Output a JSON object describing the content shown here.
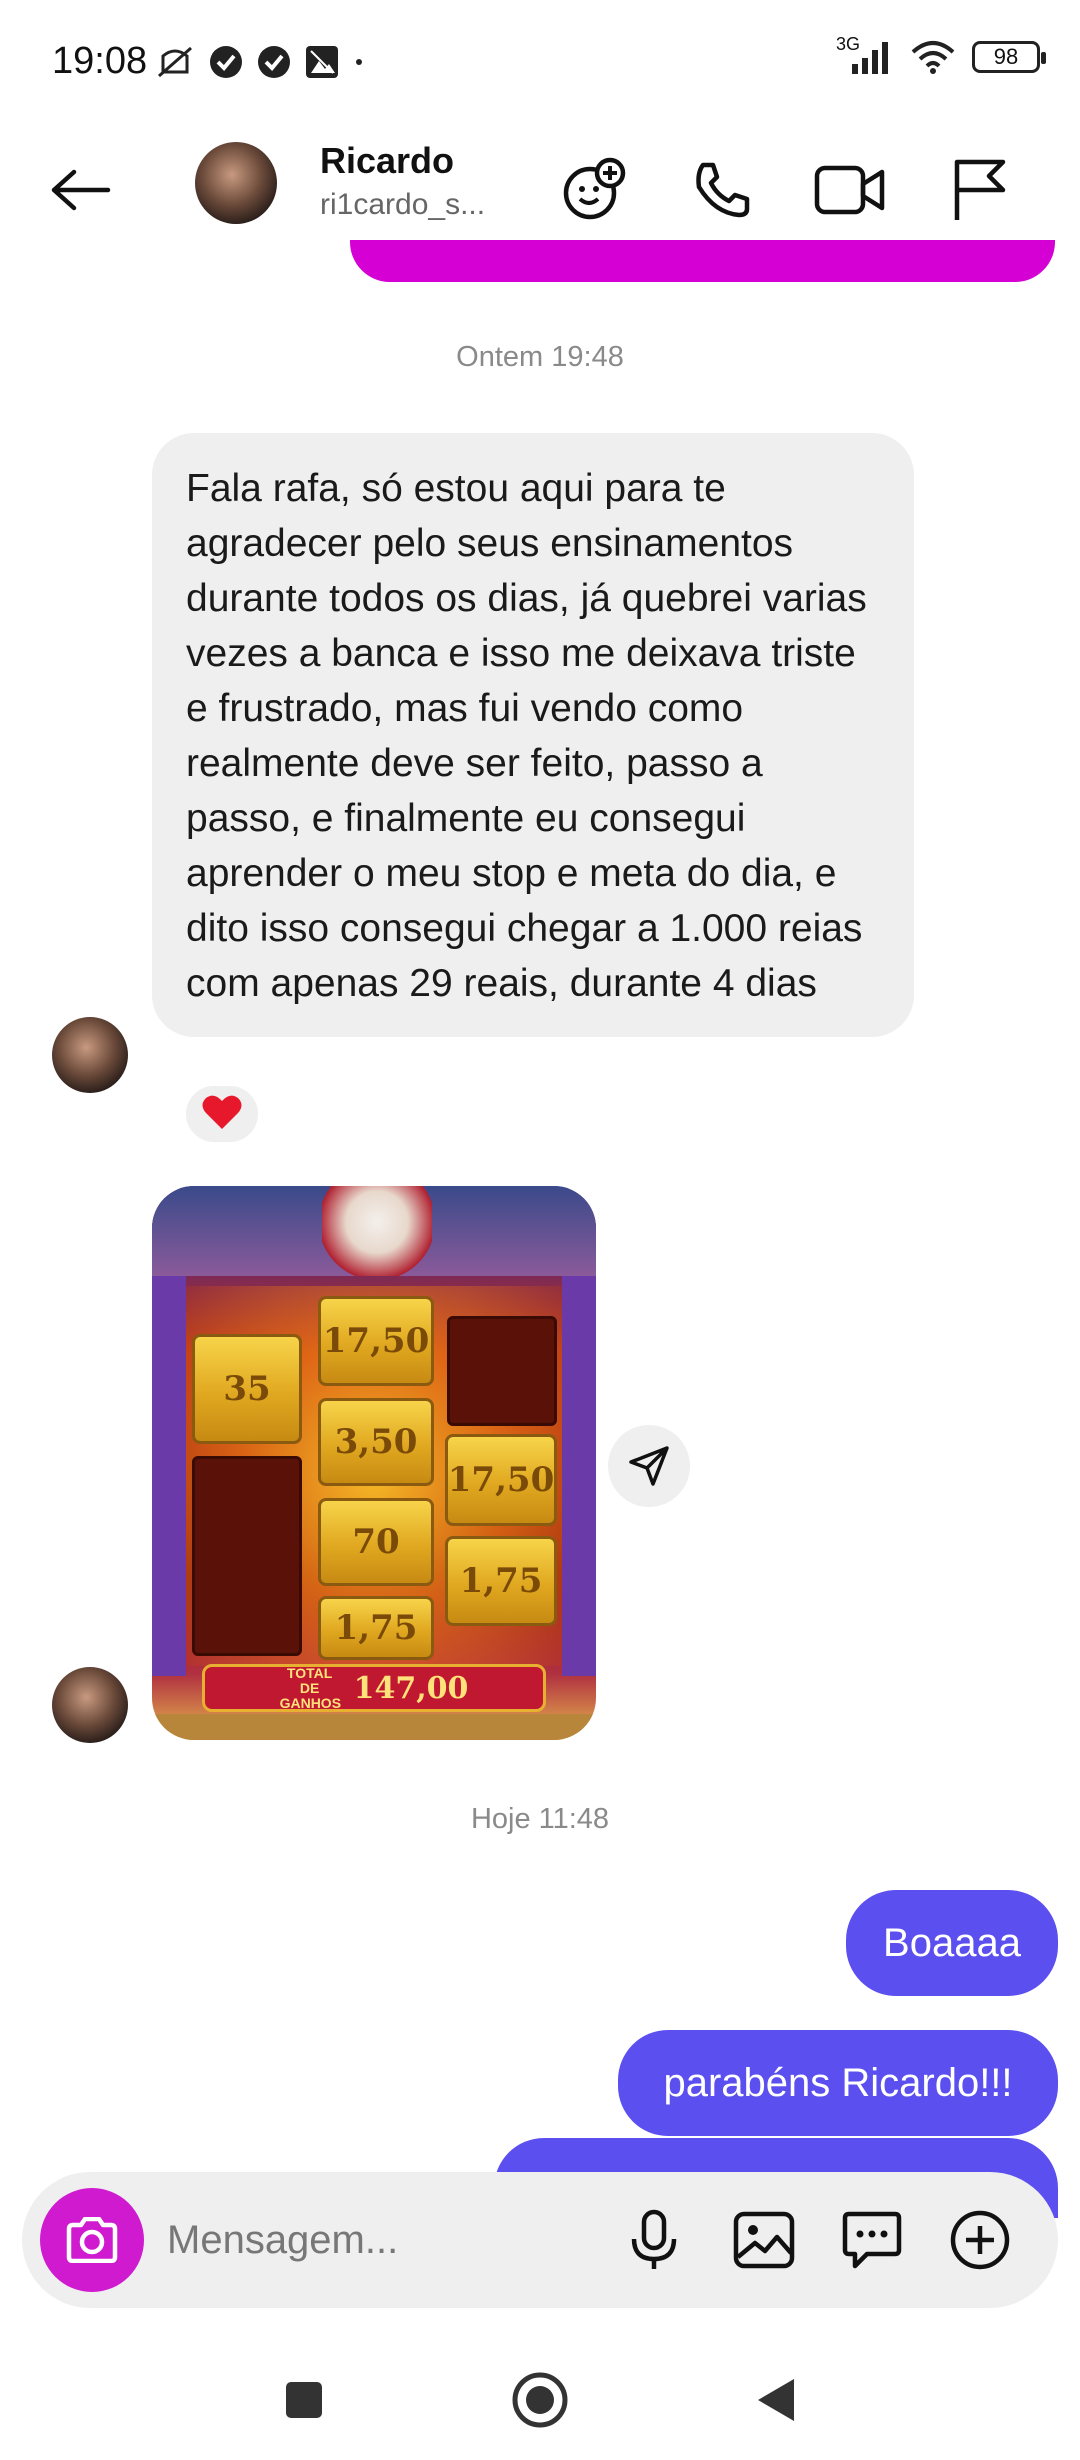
{
  "status_bar": {
    "time": "19:08",
    "network": "3G",
    "battery": "98",
    "icons_left": [
      "mute-vibrate-icon",
      "check-circle-icon",
      "check-circle-icon",
      "photo-app-icon",
      "dot-icon"
    ],
    "icons_right": [
      "signal-icon",
      "wifi-icon",
      "battery-icon"
    ]
  },
  "header": {
    "contact_name": "Ricardo",
    "username": "ri1cardo_s...",
    "actions": [
      "sticker-add-icon",
      "phone-icon",
      "video-icon",
      "flag-icon"
    ]
  },
  "messages": {
    "timestamp_1": "Ontem 19:48",
    "incoming_text": "Fala rafa, só estou aqui para te agradecer pelo seus ensinamentos durante todos os dias, já quebrei varias vezes a banca e isso me deixava triste e frustrado, mas fui vendo como realmente deve ser feito, passo a passo, e finalmente eu consegui aprender o meu stop e meta do dia, e dito isso consegui chegar a 1.000 reias com apenas 29 reais, durante 4 dias",
    "reaction": "❤️",
    "timestamp_2": "Hoje 11:48",
    "outgoing_1": "Boaaaa",
    "outgoing_2": "parabéns Ricardo!!!"
  },
  "game_image": {
    "tiles": [
      "17,50",
      "35",
      "3,50",
      "17,50",
      "70",
      "1,75",
      "1,75"
    ],
    "total_label": "TOTAL DE GANHOS",
    "total_value": "147,00"
  },
  "composer": {
    "placeholder": "Mensagem...",
    "icons": [
      "camera-icon",
      "microphone-icon",
      "gallery-icon",
      "sticker-chat-icon",
      "plus-circle-icon"
    ]
  },
  "colors": {
    "accent_outgoing": "#5b4ff0",
    "camera_button": "#d01ad0",
    "incoming_bubble": "#efefef"
  }
}
